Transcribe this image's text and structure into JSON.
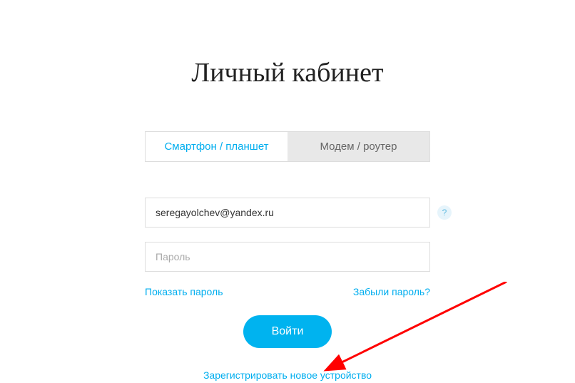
{
  "title": "Личный кабинет",
  "tabs": {
    "smartphone": "Смартфон / планшет",
    "modem": "Модем / роутер"
  },
  "form": {
    "email_value": "seregayolchev@yandex.ru",
    "password_placeholder": "Пароль",
    "help_symbol": "?",
    "show_password": "Показать пароль",
    "forgot_password": "Забыли пароль?",
    "submit": "Войти",
    "register": "Зарегистрировать новое устройство"
  }
}
